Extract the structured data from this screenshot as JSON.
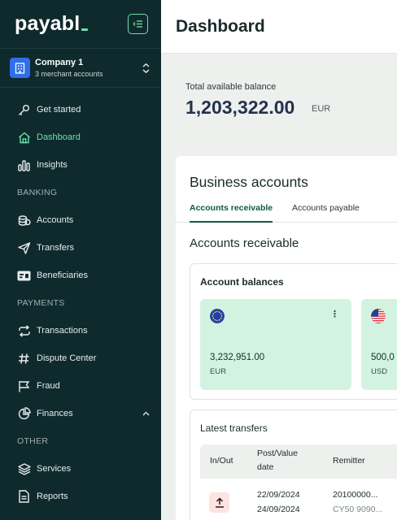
{
  "brand": {
    "logo": "payabl"
  },
  "company": {
    "name": "Company 1",
    "subtitle": "3 merchant accounts"
  },
  "nav": {
    "get_started": "Get started",
    "dashboard": "Dashboard",
    "insights": "Insights",
    "banking_label": "BANKING",
    "accounts": "Accounts",
    "transfers": "Transfers",
    "beneficiaries": "Beneficiaries",
    "payments_label": "PAYMENTS",
    "transactions": "Transactions",
    "dispute_center": "Dispute Center",
    "fraud": "Fraud",
    "finances": "Finances",
    "other_label": "OTHER",
    "services": "Services",
    "reports": "Reports"
  },
  "page": {
    "title": "Dashboard"
  },
  "balance": {
    "label": "Total available balance",
    "amount": "1,203,322.00",
    "currency": "EUR"
  },
  "business_accounts": {
    "title": "Business accounts",
    "tabs": {
      "receivable": "Accounts receivable",
      "payable": "Accounts payable"
    },
    "heading": "Accounts receivable",
    "balances_title": "Account balances",
    "cards": [
      {
        "flag": "eu-flag-icon",
        "amount": "3,232,951.00",
        "currency": "EUR"
      },
      {
        "flag": "us-flag-icon",
        "amount": "500,0",
        "currency": "USD"
      }
    ]
  },
  "transfers": {
    "title": "Latest transfers",
    "columns": {
      "in_out": "In/Out",
      "post_line1": "Post/Value",
      "post_line2": "date",
      "remitter": "Remitter"
    },
    "rows": [
      {
        "post_date": "22/09/2024",
        "value_date": "24/09/2024",
        "remitter": "20100000...",
        "remitter_sub": "CY50 9090..."
      }
    ]
  },
  "colors": {
    "sidebar": "#0f2a2d",
    "accent": "#6fe0a9",
    "card_green": "#d3f3e1",
    "tab_active": "#0f5b3c"
  }
}
